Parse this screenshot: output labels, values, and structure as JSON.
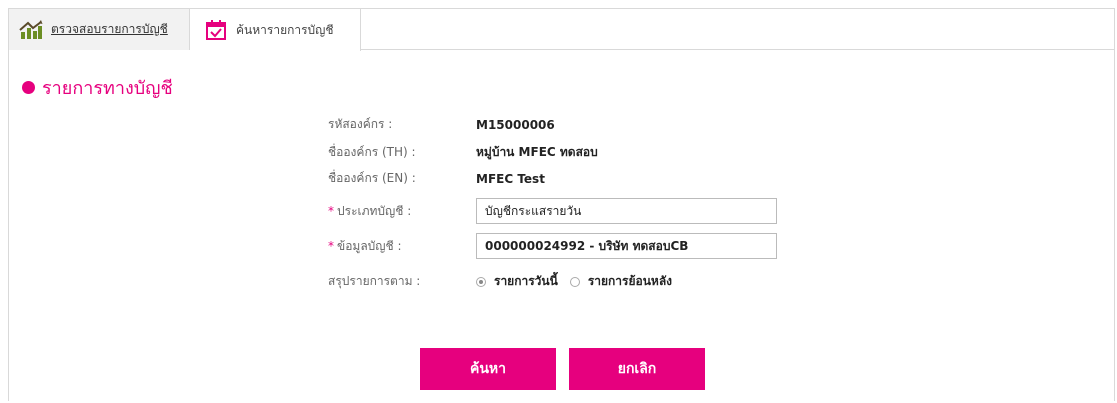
{
  "tabs": [
    {
      "label": "ตรวจสอบรายการบัญชี",
      "icon": "chart-growth-icon"
    },
    {
      "label": "ค้นหารายการบัญชี",
      "icon": "calendar-check-icon"
    }
  ],
  "section": {
    "title": "รายการทางบัญชี"
  },
  "form": {
    "org_code_label": "รหัสองค์กร :",
    "org_code_value": "M15000006",
    "org_name_th_label": "ชื่อองค์กร (TH) :",
    "org_name_th_value": "หมู่บ้าน MFEC ทดสอบ",
    "org_name_en_label": "ชื่อองค์กร (EN) :",
    "org_name_en_value": "MFEC Test",
    "account_type_label": "ประเภทบัญชี :",
    "account_type_value": "บัญชีกระแสรายวัน",
    "account_info_label": "ข้อมูลบัญชี :",
    "account_info_value": "000000024992 - บริษัท ทดสอบCB",
    "summary_label": "สรุปรายการตาม :",
    "radio_today": "รายการวันนี้",
    "radio_past": "รายการย้อนหลัง",
    "required_mark": "*"
  },
  "buttons": {
    "search": "ค้นหา",
    "cancel": "ยกเลิก"
  },
  "colors": {
    "accent": "#e6007e"
  }
}
